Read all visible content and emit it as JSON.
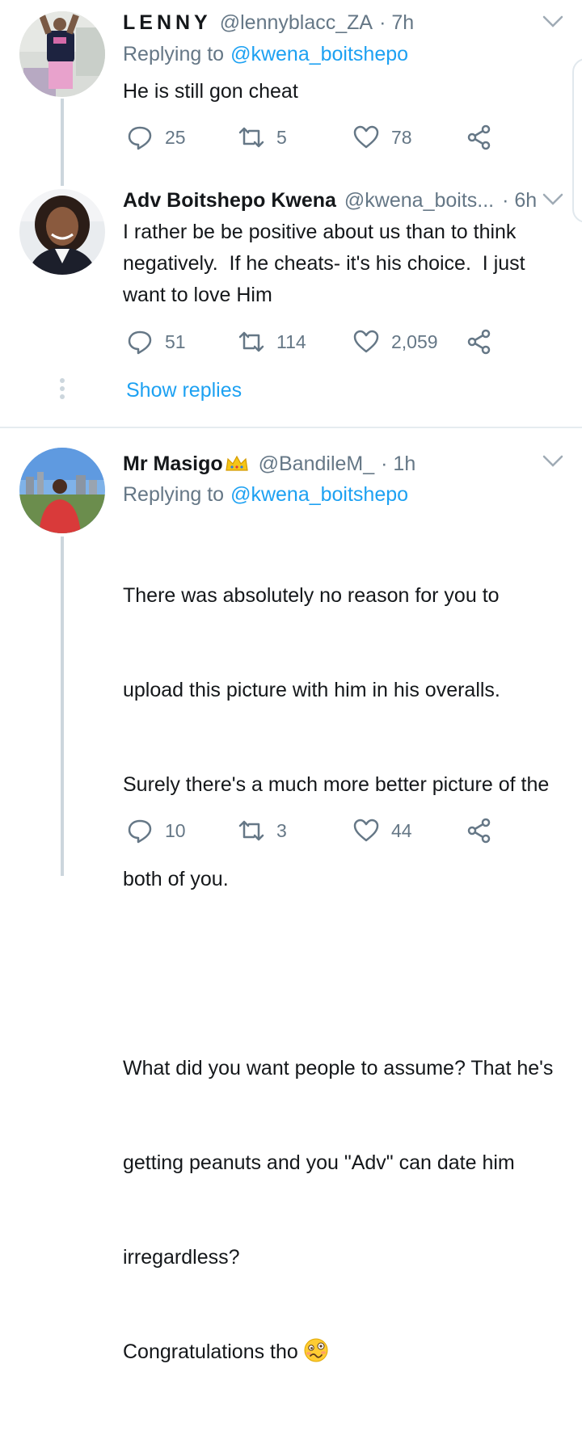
{
  "tweets": [
    {
      "name": "LENNY",
      "handle": "@lennyblacc_ZA",
      "time": "· 7h",
      "replying_label": "Replying to",
      "replying_to": "@kwena_boitshepo",
      "text": "He is still gon cheat",
      "replies": "25",
      "retweets": "5",
      "likes": "78"
    },
    {
      "name": "Adv Boitshepo Kwena",
      "handle": "@kwena_boits...",
      "time": "· 6h",
      "text": "I rather be be positive about us than to think negatively.  If he cheats- it's his choice.  I just want to love Him",
      "replies": "51",
      "retweets": "114",
      "likes": "2,059",
      "show_replies": "Show replies"
    },
    {
      "name": "Mr Masigo",
      "handle": "@BandileM_",
      "time": "· 1h",
      "replying_label": "Replying to",
      "replying_to": "@kwena_boitshepo",
      "text_lines": [
        "There was absolutely no reason for you to",
        "upload this picture with him in his overalls.",
        "Surely there's a much more better picture of the",
        "both of you.",
        "",
        "What did you want people to assume? That he's",
        "getting peanuts and you \"Adv\" can date him",
        "irregardless?"
      ],
      "last_line": "Congratulations tho",
      "replies": "10",
      "retweets": "3",
      "likes": "44"
    }
  ],
  "colors": {
    "link": "#1da1f2",
    "secondary": "#657786",
    "thread_line": "#ccd6dd",
    "divider": "#e6ecf0"
  },
  "icons": [
    "reply-icon",
    "retweet-icon",
    "like-icon",
    "share-icon",
    "chevron-down-icon",
    "crown-emoji",
    "woozy-face-emoji"
  ]
}
